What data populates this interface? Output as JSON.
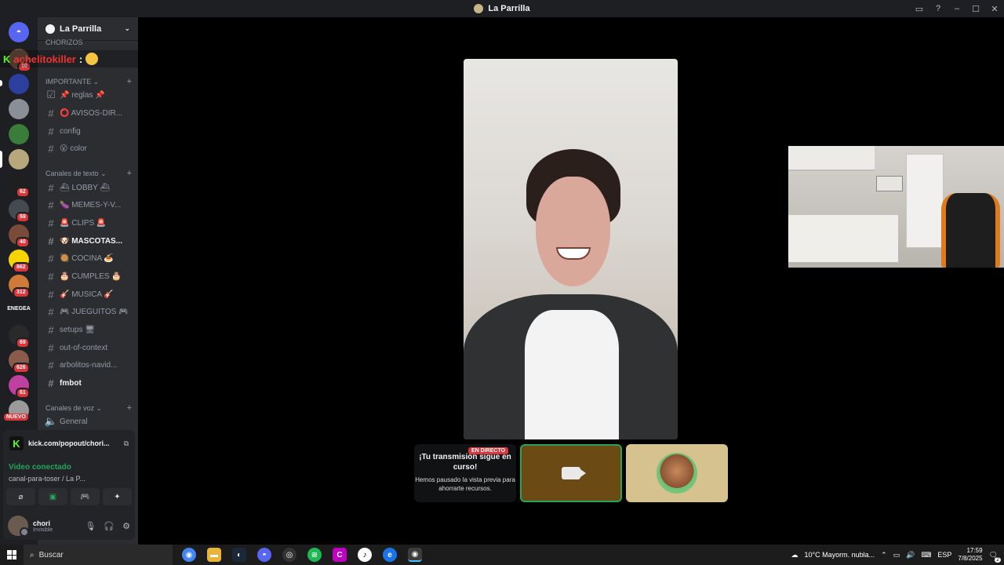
{
  "window": {
    "title": "La Parrilla"
  },
  "server": {
    "name": "La Parrilla"
  },
  "top_user_banner": "achelitokiller",
  "guild_badges": [
    "10",
    "62",
    "59",
    "40",
    "862",
    "312",
    "69",
    "626",
    "61"
  ],
  "guild_labels": {
    "enegea": "ENEGEA",
    "nuevo": "NUEVO"
  },
  "categories": {
    "hidden": "CHORIZOS",
    "important": "IMPORTANTE",
    "text": "Canales de texto",
    "voice": "Canales de voz"
  },
  "channels_important": [
    {
      "name": "📌 reglas 📌"
    },
    {
      "name": "⭕ AVISOS-DIR..."
    },
    {
      "name": "config"
    },
    {
      "name": "😮 color"
    }
  ],
  "channels_text": [
    {
      "name": "⛴ LOBBY ⛴"
    },
    {
      "name": "🍆 MEMES-Y-V..."
    },
    {
      "name": "🚨 CLIPS 🚨"
    },
    {
      "name": "🐶 MASCOTAS..."
    },
    {
      "name": "🥘 COCINA 🍝"
    },
    {
      "name": "🎂 CUMPLES 🎂"
    },
    {
      "name": "🎸 MUSICA 🎸"
    },
    {
      "name": "🎮 JUEGUITOS 🎮"
    },
    {
      "name": "setups 🖥"
    },
    {
      "name": "out-of-context"
    },
    {
      "name": "arbolitos-navid..."
    },
    {
      "name": "fmbot"
    }
  ],
  "channels_voice": [
    {
      "name": "General"
    }
  ],
  "activity": {
    "url": "kick.com/popout/chori..."
  },
  "voice_status": {
    "title": "Video conectado",
    "subtitle": "canal-para-toser / La P..."
  },
  "user": {
    "name": "chori",
    "status": "Invisible"
  },
  "stream_card": {
    "tag": "EN DIRECTO",
    "title": "¡Tu transmisión sigue en curso!",
    "desc": "Hemos pausado la vista previa para ahorrarte recursos."
  },
  "taskbar": {
    "search": "Buscar",
    "weather": "10°C  Mayorm. nubla...",
    "lang": "ESP",
    "time": "17:59",
    "date": "7/8/2025",
    "notif_count": "2"
  },
  "colors": {
    "accent_green": "#23a55a",
    "badge_red": "#da373c",
    "sidebar": "#2b2d31"
  }
}
